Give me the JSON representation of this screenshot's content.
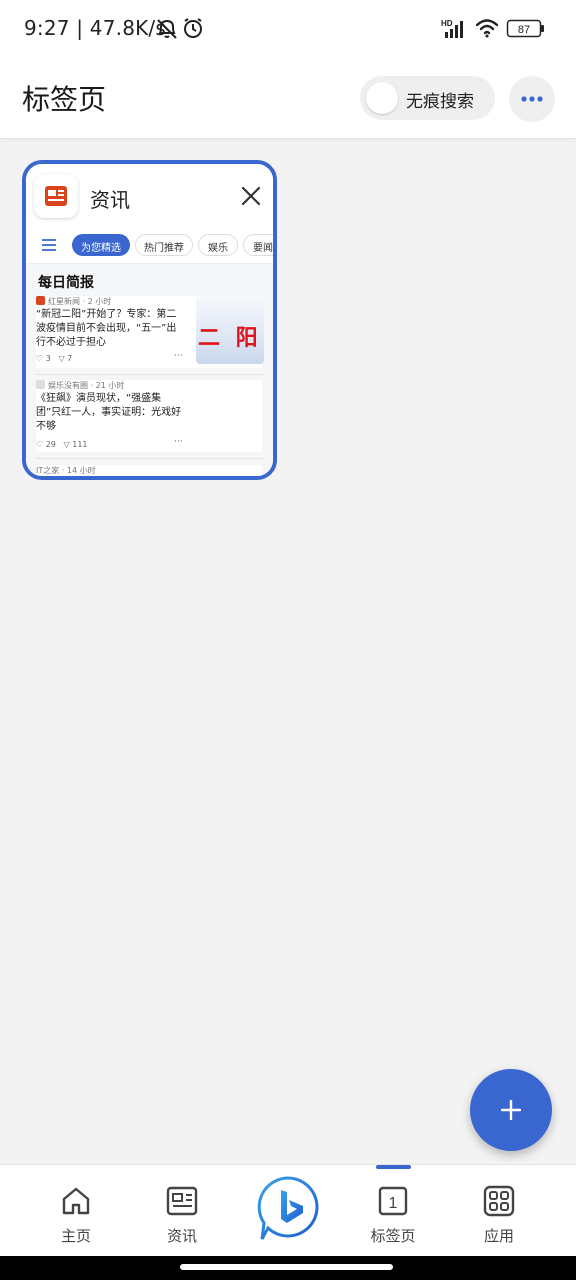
{
  "status_bar": {
    "time": "9:27",
    "net_speed": "47.8K/s",
    "battery": "87",
    "hd_label": "HD"
  },
  "header": {
    "title": "标签页",
    "private_label": "无痕搜索"
  },
  "tab": {
    "title": "资讯",
    "preview": {
      "chips": [
        "为您精选",
        "热门推荐",
        "娱乐",
        "要闻"
      ],
      "section_title": "每日简报",
      "items": [
        {
          "source": "红星新闻 · 2 小时",
          "headline": "“新冠二阳”开始了？专家：第二波疫情目前不会出现，“五一”出行不必过于担心",
          "likes": "3",
          "comments": "7",
          "thumb_text": "二 阳"
        },
        {
          "source": "娱乐没有圈 · 21 小时",
          "headline": "《狂飙》演员现状，“强盛集团”只红一人，事实证明：光戏好不够",
          "likes": "29",
          "comments": "111"
        },
        {
          "source": "IT之家 · 14 小时"
        }
      ]
    }
  },
  "nav": {
    "home": "主页",
    "news": "资讯",
    "tabs": "标签页",
    "tab_count": "1",
    "apps": "应用"
  },
  "colors": {
    "accent": "#3a66cf",
    "news_icon": "#d9431e"
  }
}
